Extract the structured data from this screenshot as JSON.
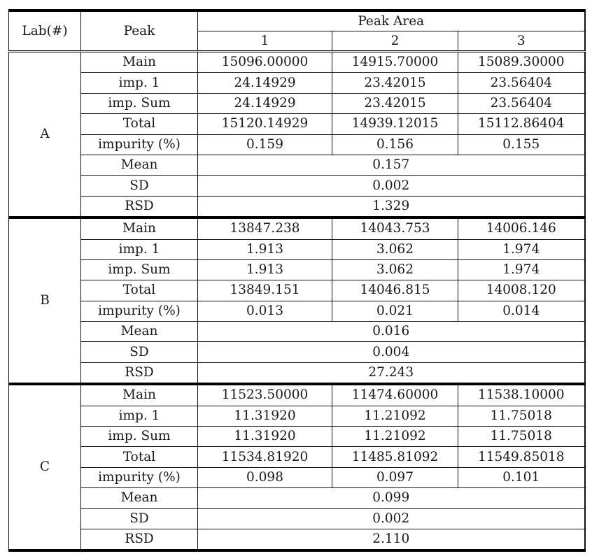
{
  "table": {
    "headers": {
      "lab": "Lab(#)",
      "peak": "Peak",
      "peak_area": "Peak Area",
      "runs": [
        "1",
        "2",
        "3"
      ]
    },
    "groups": [
      {
        "lab": "A",
        "rows": [
          {
            "label": "Main",
            "values": [
              "15096.00000",
              "14915.70000",
              "15089.30000"
            ]
          },
          {
            "label": "imp. 1",
            "values": [
              "24.14929",
              "23.42015",
              "23.56404"
            ]
          },
          {
            "label": "imp. Sum",
            "values": [
              "24.14929",
              "23.42015",
              "23.56404"
            ]
          },
          {
            "label": "Total",
            "values": [
              "15120.14929",
              "14939.12015",
              "15112.86404"
            ]
          },
          {
            "label": "impurity (%)",
            "values": [
              "0.159",
              "0.156",
              "0.155"
            ]
          }
        ],
        "stats": [
          {
            "label": "Mean",
            "value": "0.157"
          },
          {
            "label": "SD",
            "value": "0.002"
          },
          {
            "label": "RSD",
            "value": "1.329"
          }
        ]
      },
      {
        "lab": "B",
        "rows": [
          {
            "label": "Main",
            "values": [
              "13847.238",
              "14043.753",
              "14006.146"
            ]
          },
          {
            "label": "imp. 1",
            "values": [
              "1.913",
              "3.062",
              "1.974"
            ]
          },
          {
            "label": "imp. Sum",
            "values": [
              "1.913",
              "3.062",
              "1.974"
            ]
          },
          {
            "label": "Total",
            "values": [
              "13849.151",
              "14046.815",
              "14008.120"
            ]
          },
          {
            "label": "impurity (%)",
            "values": [
              "0.013",
              "0.021",
              "0.014"
            ]
          }
        ],
        "stats": [
          {
            "label": "Mean",
            "value": "0.016"
          },
          {
            "label": "SD",
            "value": "0.004"
          },
          {
            "label": "RSD",
            "value": "27.243"
          }
        ]
      },
      {
        "lab": "C",
        "rows": [
          {
            "label": "Main",
            "values": [
              "11523.50000",
              "11474.60000",
              "11538.10000"
            ]
          },
          {
            "label": "imp. 1",
            "values": [
              "11.31920",
              "11.21092",
              "11.75018"
            ]
          },
          {
            "label": "imp. Sum",
            "values": [
              "11.31920",
              "11.21092",
              "11.75018"
            ]
          },
          {
            "label": "Total",
            "values": [
              "11534.81920",
              "11485.81092",
              "11549.85018"
            ]
          },
          {
            "label": "impurity (%)",
            "values": [
              "0.098",
              "0.097",
              "0.101"
            ]
          }
        ],
        "stats": [
          {
            "label": "Mean",
            "value": "0.099"
          },
          {
            "label": "SD",
            "value": "0.002"
          },
          {
            "label": "RSD",
            "value": "2.110"
          }
        ]
      }
    ]
  }
}
